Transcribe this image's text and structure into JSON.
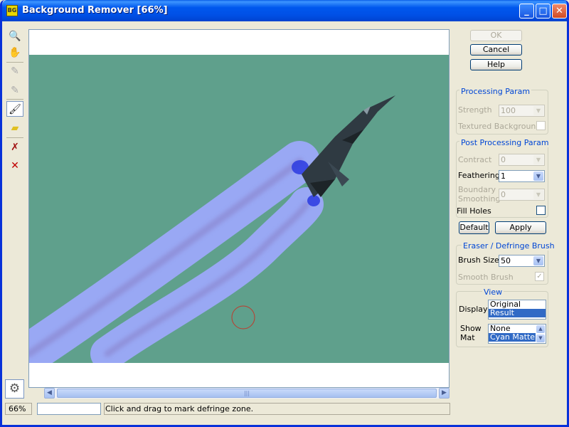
{
  "window": {
    "title": "Background Remover [66%]",
    "app_icon": "app-logo-icon"
  },
  "title_buttons": {
    "minimize": "_",
    "maximize": "□",
    "close": "✕"
  },
  "tools": [
    {
      "icon": "magnifier-icon",
      "glyph": "🔍"
    },
    {
      "icon": "hand-icon",
      "glyph": "✋"
    },
    {
      "icon": "pen-minus-icon",
      "glyph": "✎"
    },
    {
      "icon": "pen-plus-icon",
      "glyph": "✎"
    },
    {
      "icon": "defringe-brush-icon",
      "glyph": "🖌"
    },
    {
      "icon": "eraser-icon",
      "glyph": "▰"
    },
    {
      "icon": "clear-marks-icon",
      "glyph": "✗"
    },
    {
      "icon": "delete-icon",
      "glyph": "✕"
    }
  ],
  "buttons": {
    "ok": "OK",
    "cancel": "Cancel",
    "help": "Help",
    "default": "Default",
    "apply": "Apply"
  },
  "processing": {
    "legend": "Processing Param",
    "strength_label": "Strength",
    "strength_value": "100",
    "textured_label": "Textured Background",
    "textured_checked": false
  },
  "post_processing": {
    "legend": "Post Processing Param",
    "contract_label": "Contract",
    "contract_value": "0",
    "feathering_label": "Feathering",
    "feathering_value": "1",
    "boundary_label_1": "Boundary",
    "boundary_label_2": "Smoothing",
    "boundary_value": "0",
    "fill_holes_label": "Fill Holes",
    "fill_holes_checked": false
  },
  "eraser": {
    "legend": "Eraser / Defringe  Brush",
    "brush_size_label": "Brush Size",
    "brush_size_value": "50",
    "smooth_label": "Smooth Brush",
    "smooth_checked": true
  },
  "view": {
    "legend": "View",
    "display_label": "Display",
    "display_options": [
      "Original",
      "Result"
    ],
    "display_selected": "Result",
    "show_label_1": "Show",
    "show_label_2": "Mat",
    "mat_options": [
      "None",
      "Cyan Matte"
    ],
    "mat_selected": "Cyan Matte"
  },
  "status": {
    "zoom": "66%",
    "message": "Click and drag to mark defringe zone."
  },
  "colors": {
    "canvas_bg": "#5fa08c",
    "trail": "#a0a8ff",
    "brush_cursor": "#c0392b",
    "accent": "#0046d5"
  }
}
